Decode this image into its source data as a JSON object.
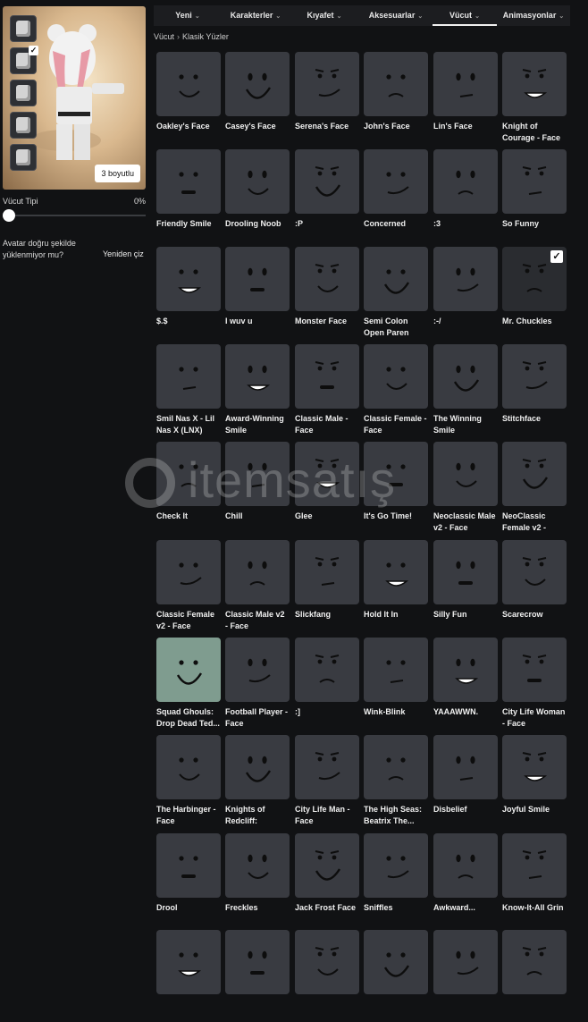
{
  "left_panel": {
    "thumbnails": [
      {
        "name": "head",
        "checked": false
      },
      {
        "name": "torso",
        "checked": true
      },
      {
        "name": "arm",
        "checked": false
      },
      {
        "name": "leg",
        "checked": false
      },
      {
        "name": "face",
        "checked": false
      }
    ],
    "view_3d_label": "3 boyutlu",
    "body_type_label": "Vücut Tipi",
    "body_type_value": "0%",
    "body_type_level": 0,
    "load_message": "Avatar doğru şekilde yüklenmiyor mu?",
    "redraw_label": "Yeniden çiz"
  },
  "nav": {
    "tabs": [
      {
        "label": "Yeni",
        "active": false
      },
      {
        "label": "Karakterler",
        "active": false
      },
      {
        "label": "Kıyafet",
        "active": false
      },
      {
        "label": "Aksesuarlar",
        "active": false
      },
      {
        "label": "Vücut",
        "active": true
      },
      {
        "label": "Animasyonlar",
        "active": false
      }
    ]
  },
  "breadcrumb": {
    "parent": "Vücut",
    "separator": "›",
    "current": "Klasik Yüzler"
  },
  "watermark": {
    "text": "itemsatış"
  },
  "faces": [
    {
      "name": "Oakley's Face"
    },
    {
      "name": "Casey's Face"
    },
    {
      "name": "Serena's Face"
    },
    {
      "name": "John's Face"
    },
    {
      "name": "Lin's Face"
    },
    {
      "name": "Knight of Courage - Face"
    },
    {
      "name": "Friendly Smile"
    },
    {
      "name": "Drooling Noob"
    },
    {
      "name": ":P"
    },
    {
      "name": "Concerned"
    },
    {
      "name": ":3"
    },
    {
      "name": "So Funny"
    },
    {
      "name": "$.$"
    },
    {
      "name": "I wuv u"
    },
    {
      "name": "Monster Face"
    },
    {
      "name": "Semi Colon Open Paren"
    },
    {
      "name": ":-/"
    },
    {
      "name": "Mr. Chuckles",
      "selected": true
    },
    {
      "name": "Smil Nas X - Lil Nas X (LNX)"
    },
    {
      "name": "Award-Winning Smile"
    },
    {
      "name": "Classic Male - Face"
    },
    {
      "name": "Classic Female - Face"
    },
    {
      "name": "The Winning Smile"
    },
    {
      "name": "Stitchface"
    },
    {
      "name": "Check It"
    },
    {
      "name": "Chill"
    },
    {
      "name": "Glee"
    },
    {
      "name": "It's Go Time!"
    },
    {
      "name": "Neoclassic Male v2 - Face"
    },
    {
      "name": "NeoClassic Female v2 - Face"
    },
    {
      "name": "Classic Female v2 - Face"
    },
    {
      "name": "Classic Male v2 - Face"
    },
    {
      "name": "Slickfang"
    },
    {
      "name": "Hold It In"
    },
    {
      "name": "Silly Fun"
    },
    {
      "name": "Scarecrow"
    },
    {
      "name": "Squad Ghouls: Drop Dead Ted..."
    },
    {
      "name": "Football Player - Face"
    },
    {
      "name": ":]"
    },
    {
      "name": "Wink-Blink"
    },
    {
      "name": "YAAAWWN."
    },
    {
      "name": "City Life Woman - Face"
    },
    {
      "name": "The Harbinger - Face"
    },
    {
      "name": "Knights of Redcliff: Paladi..."
    },
    {
      "name": "City Life Man - Face"
    },
    {
      "name": "The High Seas: Beatrix The..."
    },
    {
      "name": "Disbelief"
    },
    {
      "name": "Joyful Smile"
    },
    {
      "name": "Drool"
    },
    {
      "name": "Freckles"
    },
    {
      "name": "Jack Frost Face"
    },
    {
      "name": "Sniffles"
    },
    {
      "name": "Awkward..."
    },
    {
      "name": "Know-It-All Grin"
    },
    {
      "name": ""
    },
    {
      "name": ""
    },
    {
      "name": ""
    },
    {
      "name": ""
    },
    {
      "name": ""
    },
    {
      "name": ""
    }
  ]
}
